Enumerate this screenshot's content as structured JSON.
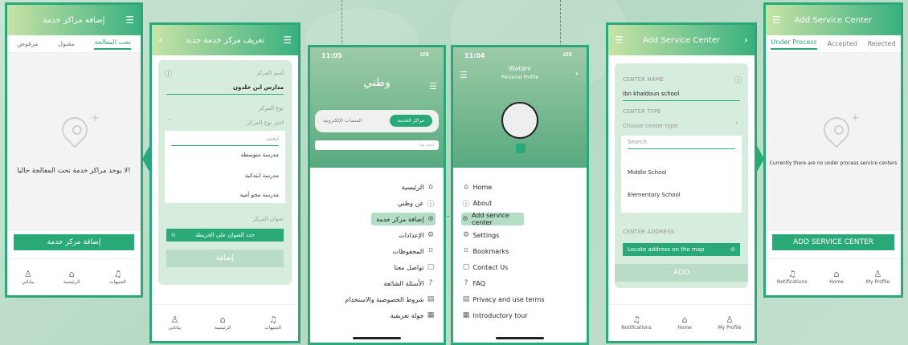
{
  "screen1": {
    "title": "إضافة مراكز خدمة",
    "tabs": [
      "مرفوض",
      "مقبول",
      "تحت المعالجة"
    ],
    "empty_message": "لا يوجد مراكز خدمة تحت المعالجة حاليا!",
    "add_button": "إضافة مركز خدمة",
    "nav": [
      "بياناتي",
      "الرئيسية",
      "التنبيهات"
    ]
  },
  "screen2": {
    "title": "تعريف مركز خدمة جديد",
    "center_name_label": "اسم المركز",
    "center_name_value": "مدارس ابن خلدون",
    "center_type_label": "نوع المركز",
    "center_type_placeholder": "اختر نوع المركز",
    "search_placeholder": "ابحث",
    "options": [
      "مدرسة متوسطة",
      "مدرسة ابتدائية",
      "مدرسة محو أمية"
    ],
    "address_label": "عنوان المركز",
    "locate_label": "حدد العنوان على الخريطة",
    "add_button": "إضافة",
    "nav": [
      "بياناتي",
      "الرئيسية",
      "التنبيهات"
    ]
  },
  "screen3": {
    "time": "11:05",
    "signal": "LTE",
    "app_logo": "وطني",
    "tab_active": "مراكز الخدمة",
    "tab_other": "المنصات الإلكترونية",
    "search_placeholder": "ابحث هنا",
    "menu": [
      "الرئيسية",
      "عن وطني",
      "إضافة مركز خدمة",
      "الإعدادات",
      "المحفوظات",
      "تواصل معنا",
      "الأسئلة الشائعة",
      "شروط الخصوصية والاستخدام",
      "جولة تعريفية"
    ]
  },
  "screen4": {
    "time": "11:04",
    "signal": "LTE",
    "title": "Watani",
    "subtitle": "Personal Profile",
    "menu": [
      "Home",
      "About",
      "Add service center",
      "Settings",
      "Bookmarks",
      "Contact Us",
      "FAQ",
      "Privacy and use terms",
      "Introductory tour"
    ]
  },
  "screen5": {
    "title": "Add Service Center",
    "center_name_label": "CENTER NAME",
    "center_name_value": "Ibn khaldoun school",
    "center_type_label": "CENTER TYPE",
    "center_type_placeholder": "Choose center type",
    "search_placeholder": "Search",
    "options": [
      "Middle School",
      "Elementary School"
    ],
    "address_label": "CENTER ADDRESS",
    "locate_label": "Locate address on the map",
    "add_button": "ADD",
    "nav": [
      "Notifications",
      "Home",
      "My Profile"
    ]
  },
  "screen6": {
    "title": "Add Service Center",
    "tabs": [
      "Under Process",
      "Accepted",
      "Rejected"
    ],
    "empty_message": "Currently there are no under process service centers",
    "add_button": "ADD SERVICE CENTER",
    "nav": [
      "Notifications",
      "Home",
      "My Profile"
    ]
  },
  "colors": {
    "primary": "#2aa978",
    "light_green": "#d6ecdd",
    "background": "#c9e4d3"
  },
  "icons": [
    "menu-icon",
    "back-icon",
    "location-pin-icon",
    "home-icon",
    "bell-icon",
    "person-icon",
    "info-icon",
    "plus-circle-icon",
    "gear-icon",
    "bookmark-icon",
    "chat-icon",
    "question-icon",
    "document-icon",
    "tour-icon",
    "avatar-icon"
  ]
}
